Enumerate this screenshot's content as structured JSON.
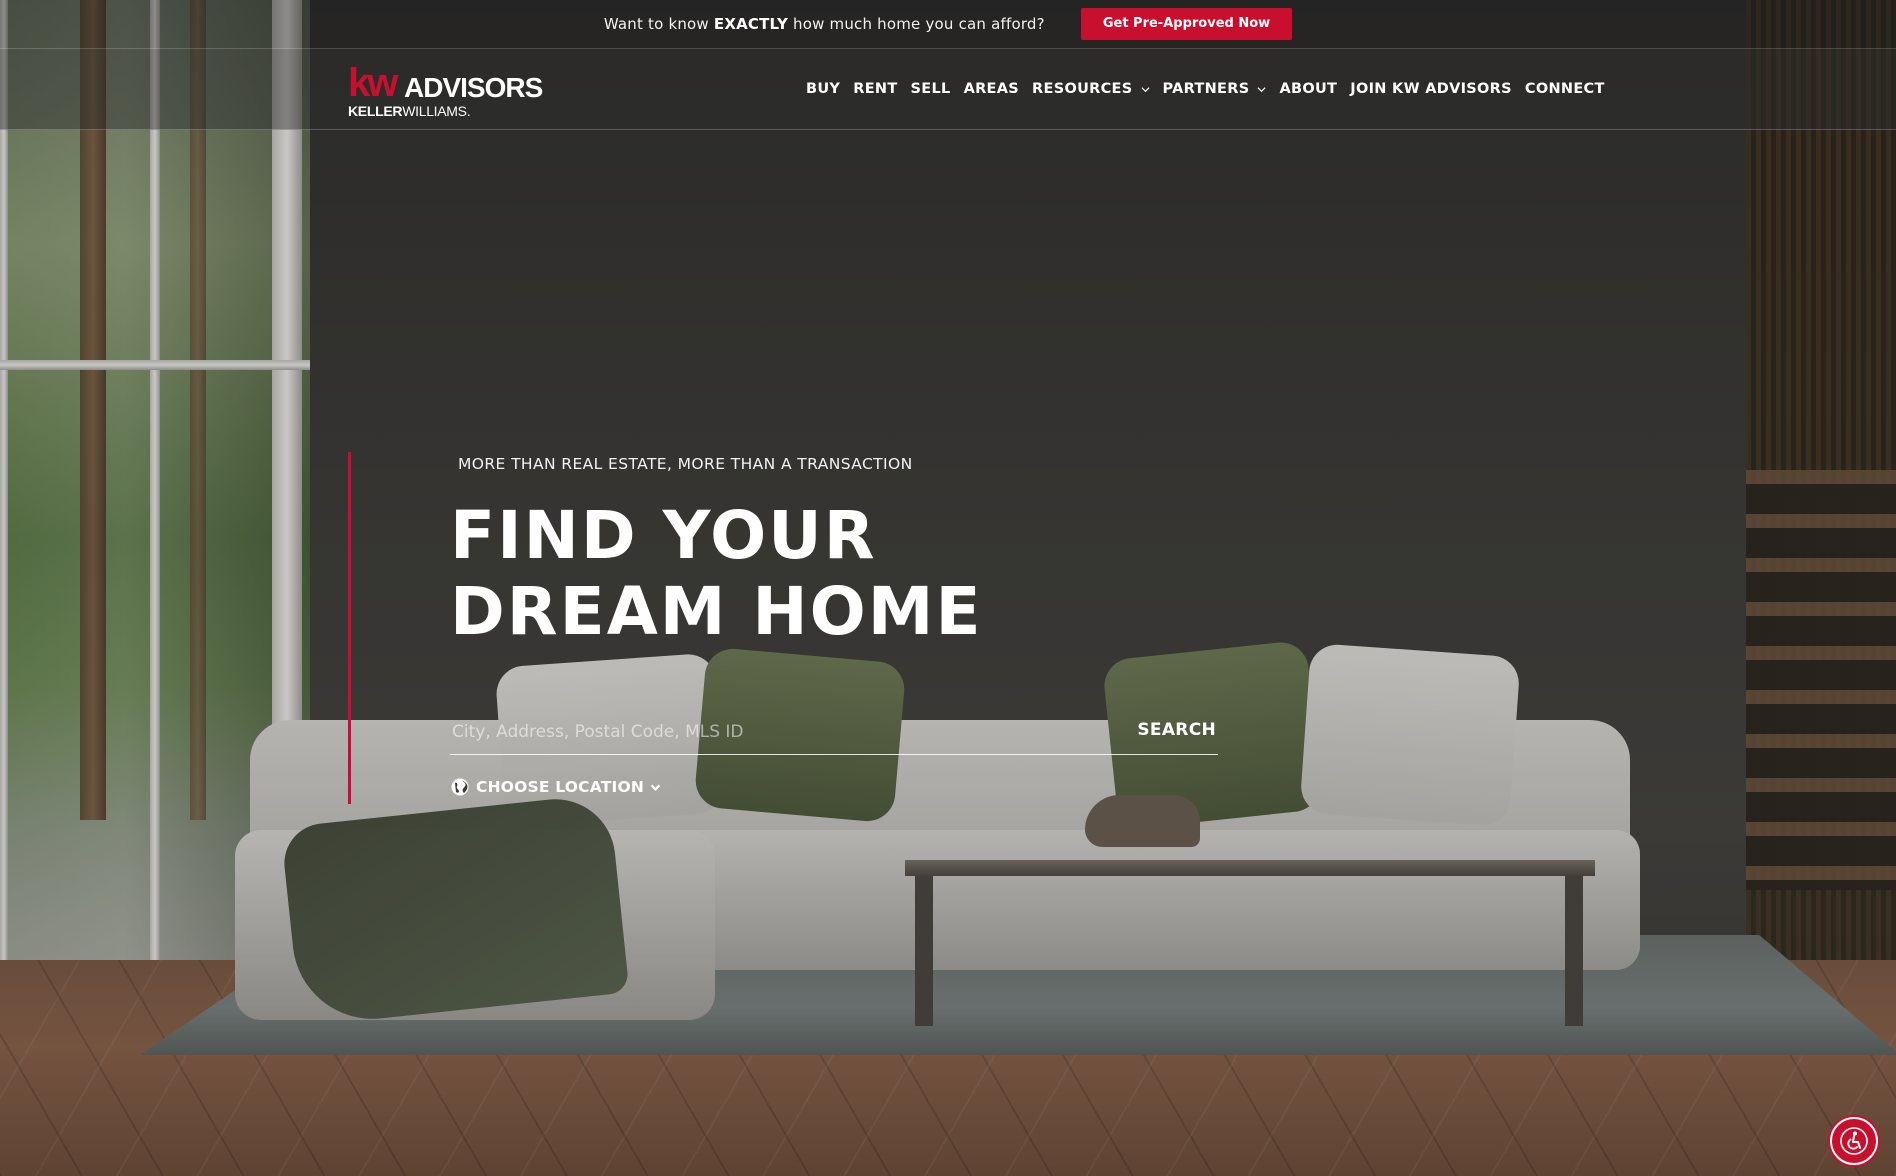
{
  "topbar": {
    "prefix": "Want to know",
    "emphasis": "EXACTLY",
    "suffix": "how much home you can afford?",
    "cta_label": "Get Pre-Approved Now"
  },
  "logo": {
    "kw": "kw",
    "advisors": "ADVISORS",
    "brand_keller": "KELLER",
    "brand_williams": "WILLIAMS."
  },
  "nav": {
    "items": [
      {
        "label": "BUY",
        "has_dropdown": false
      },
      {
        "label": "RENT",
        "has_dropdown": false
      },
      {
        "label": "SELL",
        "has_dropdown": false
      },
      {
        "label": "AREAS",
        "has_dropdown": false
      },
      {
        "label": "RESOURCES",
        "has_dropdown": true
      },
      {
        "label": "PARTNERS",
        "has_dropdown": true
      },
      {
        "label": "ABOUT",
        "has_dropdown": false
      },
      {
        "label": "JOIN KW ADVISORS",
        "has_dropdown": false
      },
      {
        "label": "CONNECT",
        "has_dropdown": false
      }
    ]
  },
  "hero": {
    "tagline": "MORE THAN REAL ESTATE, MORE THAN A TRANSACTION",
    "headline_line1": "FIND YOUR",
    "headline_line2": "DREAM HOME",
    "search_placeholder": "City, Address, Postal Code, MLS ID",
    "search_value": "",
    "search_button": "SEARCH",
    "location_label": "CHOOSE LOCATION"
  },
  "icons": {
    "location": "globe-icon",
    "dropdown": "chevron-down-icon",
    "accessibility": "accessibility-icon"
  },
  "colors": {
    "brand_red": "#c8102e",
    "text_white": "#ffffff"
  }
}
